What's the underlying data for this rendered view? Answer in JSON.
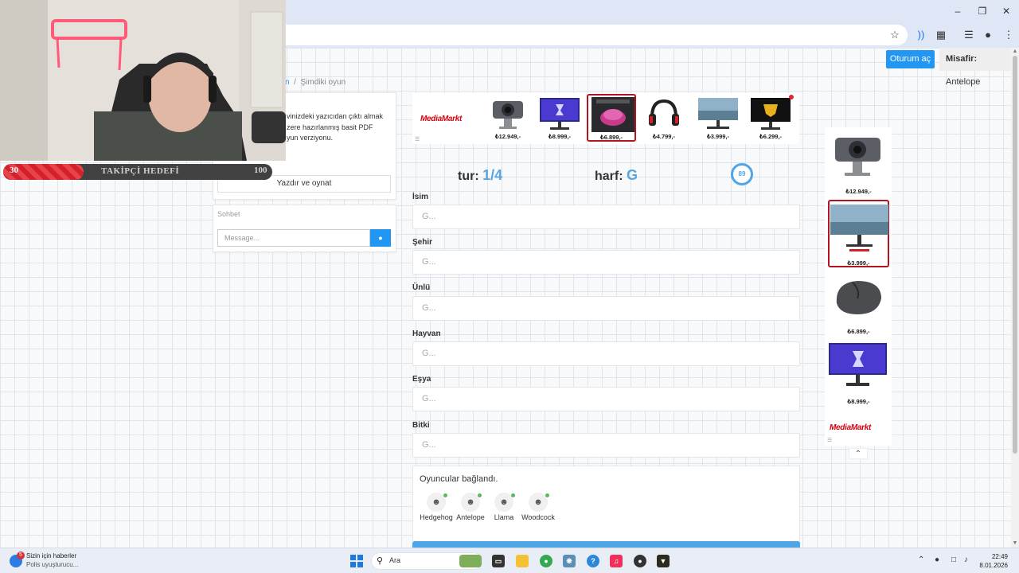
{
  "browser": {
    "page_button": "Oturum aç",
    "guest_label": "Misafir:",
    "guest_name": "Antelope"
  },
  "breadcrumb": {
    "link": "n",
    "separator": "/",
    "current": "Şimdiki oyun"
  },
  "left_card": {
    "info_lines": [
      "vinizdeki yazıcıdan çıktı almak",
      "zere hazırlanmış basit PDF",
      "yun verziyonu."
    ],
    "print_button": "Yazdır ve oynat"
  },
  "chat": {
    "title": "Sohbet",
    "placeholder": "Message..."
  },
  "ads": {
    "brand": "MediaMarkt",
    "top": [
      {
        "price": "₺12.949,-",
        "icon": "webcam"
      },
      {
        "price": "₺8.999,-",
        "icon": "gaming-monitor"
      },
      {
        "price": "₺6.899,-",
        "icon": "mouse-promo",
        "selected": true
      },
      {
        "price": "₺4.799,-",
        "icon": "headset"
      },
      {
        "price": "₺3.999,-",
        "icon": "monitor"
      },
      {
        "price": "₺6.299,-",
        "icon": "tuf-monitor"
      }
    ],
    "side": [
      {
        "price": "₺12.949,-",
        "icon": "webcam"
      },
      {
        "price": "₺3.999,-",
        "icon": "monitor",
        "selected": true
      },
      {
        "price": "₺6.899,-",
        "icon": "mouse"
      },
      {
        "price": "₺8.999,-",
        "icon": "gaming-monitor"
      }
    ]
  },
  "game": {
    "round_label": "tur:",
    "round_value": "1/4",
    "letter_label": "harf:",
    "letter_value": "G",
    "timer": "89",
    "fields": [
      {
        "label": "İsim",
        "placeholder": "G..."
      },
      {
        "label": "Şehir",
        "placeholder": "G..."
      },
      {
        "label": "Ünlü",
        "placeholder": "G..."
      },
      {
        "label": "Hayvan",
        "placeholder": "G..."
      },
      {
        "label": "Eşya",
        "placeholder": "G..."
      },
      {
        "label": "Bitki",
        "placeholder": "G..."
      }
    ],
    "players_title": "Oyuncular bağlandı.",
    "players": [
      "Hedgehog",
      "Antelope",
      "Llama",
      "Woodcock"
    ]
  },
  "stream_overlay": {
    "goal_current": "30",
    "goal_label": "TAKİPÇİ HEDEFİ",
    "goal_target": "100",
    "goal_progress": 0.3
  },
  "taskbar": {
    "news_badge": "5",
    "news_title": "Sizin için haberler",
    "news_sub": "Polis uyuşturucu...",
    "search_label": "Ara",
    "time": "22:49",
    "date": "8.01.2026"
  }
}
